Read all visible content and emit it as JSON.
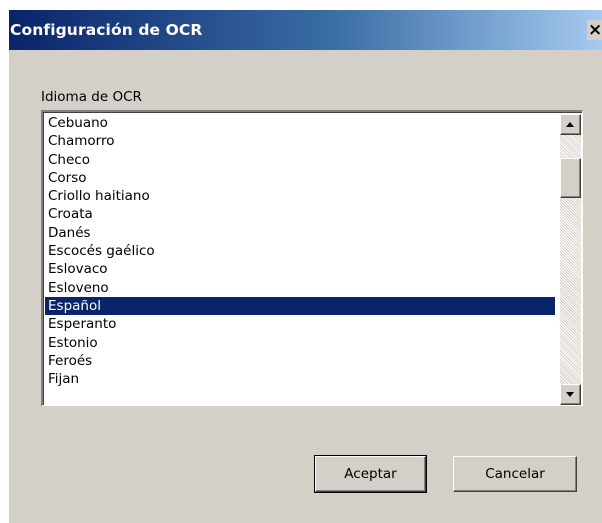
{
  "window": {
    "title": "Configuración de OCR",
    "close_label": "×"
  },
  "ocr_language": {
    "label": "Idioma de OCR",
    "items": [
      "Cebuano",
      "Chamorro",
      "Checo",
      "Corso",
      "Criollo haitiano",
      "Croata",
      "Danés",
      "Escocés gaélico",
      "Eslovaco",
      "Esloveno",
      "Español",
      "Esperanto",
      "Estonio",
      "Feroés",
      "Fijan"
    ],
    "selected": "Español"
  },
  "buttons": {
    "accept_label": "Aceptar",
    "cancel_label": "Cancelar"
  },
  "colors": {
    "title_gradient_start": "#0a246a",
    "title_gradient_end": "#a6caf0",
    "selection": "#0a246a",
    "dialog_background": "#d4d0c8"
  }
}
